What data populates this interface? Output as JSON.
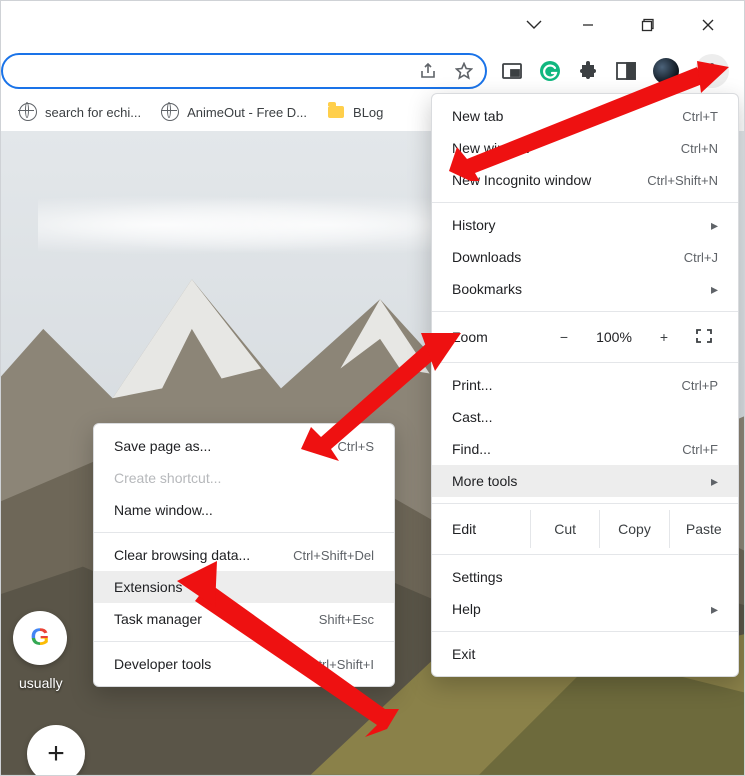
{
  "window": {
    "chevron": "⌄",
    "min": "—",
    "max": "❐",
    "close": "×"
  },
  "bookmarks": [
    {
      "label": "search for echi...",
      "icon": "globe"
    },
    {
      "label": "AnimeOut - Free D...",
      "icon": "globe"
    },
    {
      "label": "BLog",
      "icon": "folder"
    }
  ],
  "content": {
    "chip_label": "usually"
  },
  "main_menu": {
    "s1": [
      {
        "label": "New tab",
        "shortcut": "Ctrl+T"
      },
      {
        "label": "New window",
        "shortcut": "Ctrl+N"
      },
      {
        "label": "New Incognito window",
        "shortcut": "Ctrl+Shift+N"
      }
    ],
    "s2": [
      {
        "label": "History",
        "submenu": true
      },
      {
        "label": "Downloads",
        "shortcut": "Ctrl+J"
      },
      {
        "label": "Bookmarks",
        "submenu": true
      }
    ],
    "zoom": {
      "label": "Zoom",
      "value": "100%",
      "minus": "−",
      "plus": "+"
    },
    "s3": [
      {
        "label": "Print...",
        "shortcut": "Ctrl+P"
      },
      {
        "label": "Cast..."
      },
      {
        "label": "Find...",
        "shortcut": "Ctrl+F"
      },
      {
        "label": "More tools",
        "submenu": true,
        "highlight": true
      }
    ],
    "edit": {
      "label": "Edit",
      "cut": "Cut",
      "copy": "Copy",
      "paste": "Paste"
    },
    "s4": [
      {
        "label": "Settings"
      },
      {
        "label": "Help",
        "submenu": true
      }
    ],
    "s5": [
      {
        "label": "Exit"
      }
    ]
  },
  "sub_menu": {
    "items": [
      {
        "label": "Save page as...",
        "shortcut": "Ctrl+S"
      },
      {
        "label": "Create shortcut...",
        "disabled": true
      },
      {
        "label": "Name window..."
      },
      {
        "sep": true
      },
      {
        "label": "Clear browsing data...",
        "shortcut": "Ctrl+Shift+Del"
      },
      {
        "label": "Extensions",
        "highlight": true
      },
      {
        "label": "Task manager",
        "shortcut": "Shift+Esc"
      },
      {
        "sep": true
      },
      {
        "label": "Developer tools",
        "shortcut": "Ctrl+Shift+I"
      }
    ]
  }
}
